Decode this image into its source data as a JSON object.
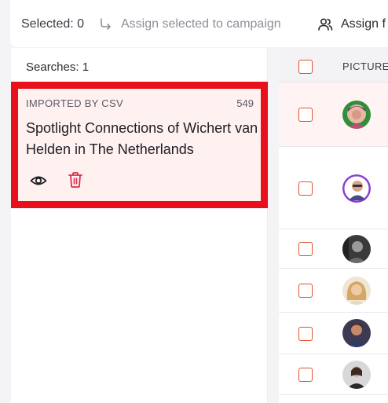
{
  "toolbar": {
    "selected_label": "Selected: 0",
    "assign_campaign_label": "Assign selected to campaign",
    "assign_f_label": "Assign f"
  },
  "sidebar": {
    "searches_label": "Searches:  1",
    "cards": [
      {
        "source": "IMPORTED BY CSV",
        "count": "549",
        "title": "Spotlight Connections of Wichert van Helden in The Netherlands",
        "actions": [
          "eye-icon",
          "trash-icon"
        ],
        "highlighted": true
      }
    ]
  },
  "table": {
    "columns": [
      "PICTURE"
    ],
    "rows": [
      {
        "avatar": "profile-picture",
        "checked": false,
        "highlighted": true
      },
      {
        "avatar": "profile-picture",
        "checked": false,
        "highlighted": false
      },
      {
        "avatar": "profile-picture",
        "checked": false,
        "highlighted": false
      },
      {
        "avatar": "profile-picture",
        "checked": false,
        "highlighted": false
      },
      {
        "avatar": "profile-picture",
        "checked": false,
        "highlighted": false
      },
      {
        "avatar": "profile-picture",
        "checked": false,
        "highlighted": false
      }
    ]
  },
  "colors": {
    "accent": "#e0522e",
    "selection_border": "#e8101a",
    "highlight_bg": "#fff1f0",
    "delete": "#d6304a"
  }
}
